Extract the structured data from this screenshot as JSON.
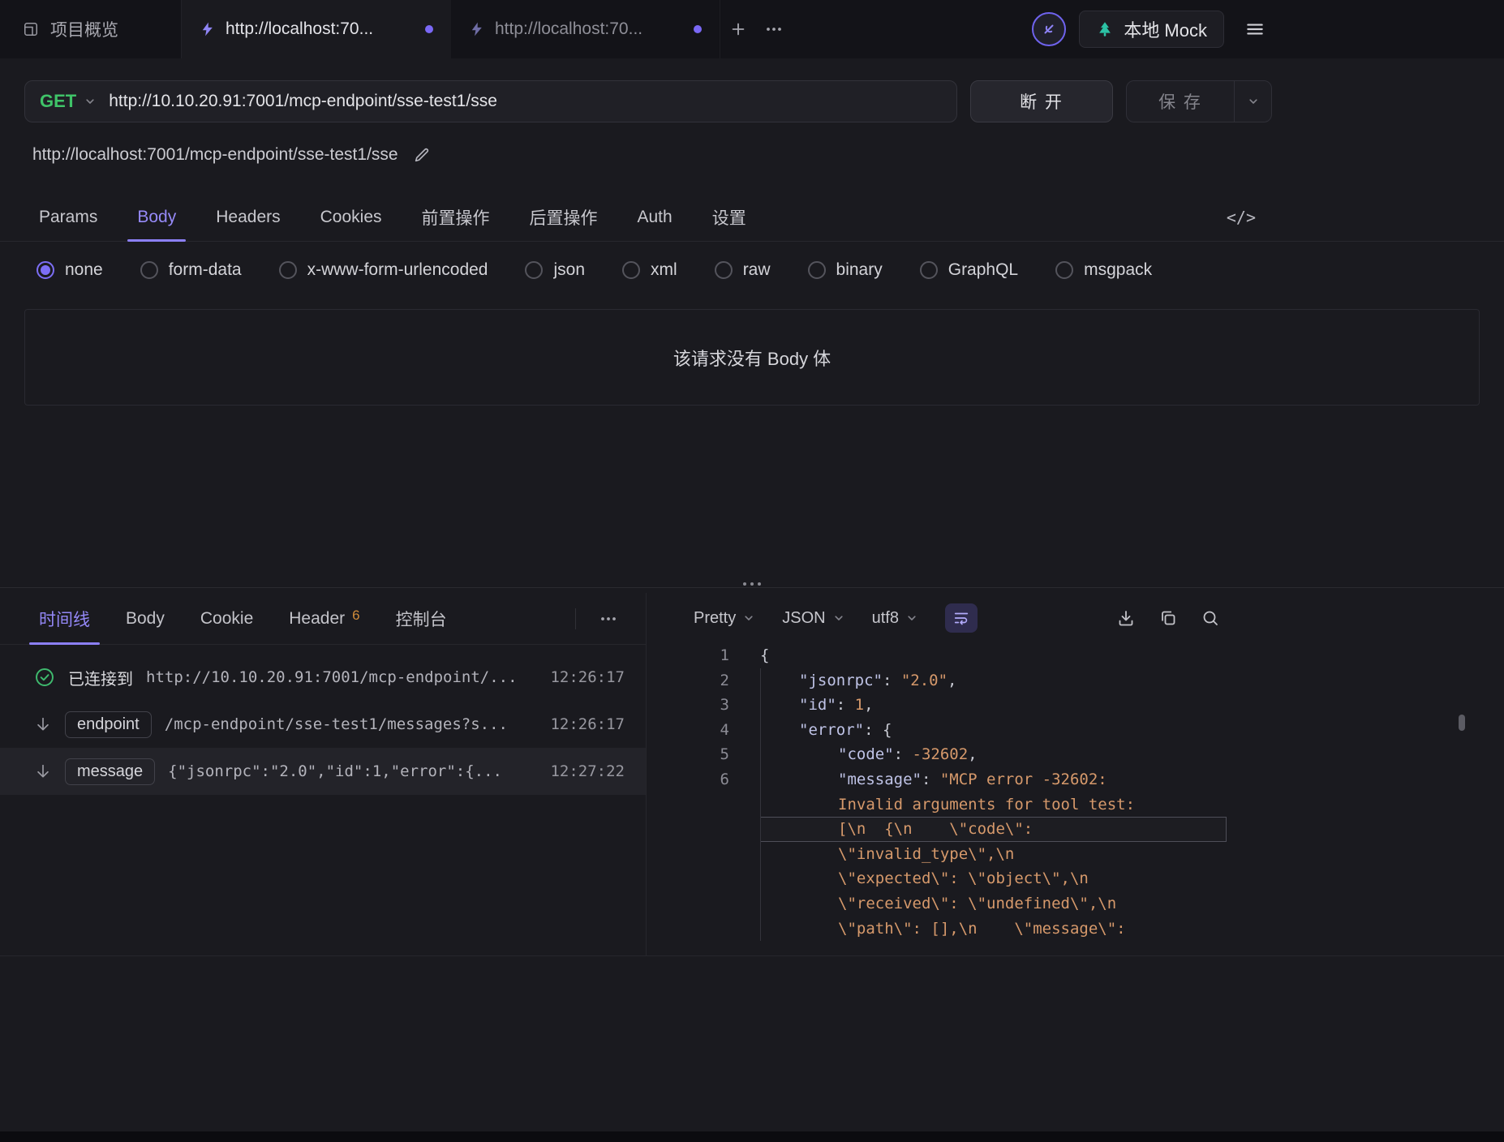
{
  "colors": {
    "accent_purple": "#8c80f8",
    "method_green": "#3fc368",
    "string_orange": "#d6996b",
    "badge_orange": "#d08c3a",
    "env_teal": "#2cc2a5",
    "success_green": "#3fba6e"
  },
  "topbar": {
    "project_tab": "项目概览",
    "doc_tabs": [
      {
        "label": "http://localhost:70...",
        "active": true
      },
      {
        "label": "http://localhost:70...",
        "active": false
      }
    ],
    "env_label": "本地 Mock"
  },
  "request": {
    "method": "GET",
    "url": "http://10.10.20.91:7001/mcp-endpoint/sse-test1/sse",
    "disconnect_label": "断 开",
    "save_label": "保 存",
    "resolved_url": "http://localhost:7001/mcp-endpoint/sse-test1/sse"
  },
  "icons": {
    "code_view": "</>"
  },
  "request_tabs": {
    "items": [
      "Params",
      "Body",
      "Headers",
      "Cookies",
      "前置操作",
      "后置操作",
      "Auth",
      "设置"
    ],
    "active": "Body"
  },
  "body_types": {
    "items": [
      "none",
      "form-data",
      "x-www-form-urlencoded",
      "json",
      "xml",
      "raw",
      "binary",
      "GraphQL",
      "msgpack"
    ],
    "selected": "none"
  },
  "body_empty_text": "该请求没有 Body 体",
  "response": {
    "tabs": [
      {
        "label": "时间线",
        "active": true
      },
      {
        "label": "Body"
      },
      {
        "label": "Cookie"
      },
      {
        "label": "Header",
        "badge": "6"
      },
      {
        "label": "控制台"
      }
    ],
    "timeline": [
      {
        "icon": "check-circle",
        "label": "已连接到",
        "text": "http://10.10.20.91:7001/mcp-endpoint/...",
        "time": "12:26:17"
      },
      {
        "icon": "arrow-down",
        "tag": "endpoint",
        "text": "/mcp-endpoint/sse-test1/messages?s...",
        "time": "12:26:17"
      },
      {
        "icon": "arrow-down",
        "tag": "message",
        "text": "{\"jsonrpc\":\"2.0\",\"id\":1,\"error\":{...",
        "time": "12:27:22",
        "selected": true
      }
    ],
    "viewer": {
      "format": "Pretty",
      "language": "JSON",
      "encoding": "utf8",
      "rows": [
        {
          "num": "1",
          "indent": 0,
          "tokens": [
            [
              "p",
              "{"
            ]
          ]
        },
        {
          "num": "2",
          "indent": 1,
          "tokens": [
            [
              "k",
              "\"jsonrpc\""
            ],
            [
              "p",
              ": "
            ],
            [
              "s",
              "\"2.0\""
            ],
            [
              "p",
              ","
            ]
          ]
        },
        {
          "num": "3",
          "indent": 1,
          "tokens": [
            [
              "k",
              "\"id\""
            ],
            [
              "p",
              ": "
            ],
            [
              "n",
              "1"
            ],
            [
              "p",
              ","
            ]
          ]
        },
        {
          "num": "4",
          "indent": 1,
          "tokens": [
            [
              "k",
              "\"error\""
            ],
            [
              "p",
              ": "
            ],
            [
              "p",
              "{"
            ]
          ]
        },
        {
          "num": "5",
          "indent": 2,
          "tokens": [
            [
              "k",
              "\"code\""
            ],
            [
              "p",
              ": "
            ],
            [
              "n",
              "-32602"
            ],
            [
              "p",
              ","
            ]
          ]
        },
        {
          "num": "6",
          "indent": 2,
          "tokens": [
            [
              "k",
              "\"message\""
            ],
            [
              "p",
              ": "
            ],
            [
              "s",
              "\"MCP error -32602:"
            ]
          ]
        },
        {
          "num": "",
          "indent": 2,
          "tokens": [
            [
              "s",
              "Invalid arguments for tool test:"
            ]
          ]
        },
        {
          "num": "",
          "indent": 2,
          "highlight": true,
          "tokens": [
            [
              "s",
              "[\\n  {\\n    \\\"code\\\":"
            ]
          ]
        },
        {
          "num": "",
          "indent": 2,
          "tokens": [
            [
              "s",
              "\\\"invalid_type\\\",\\n"
            ]
          ]
        },
        {
          "num": "",
          "indent": 2,
          "tokens": [
            [
              "s",
              "\\\"expected\\\": \\\"object\\\",\\n"
            ]
          ]
        },
        {
          "num": "",
          "indent": 2,
          "tokens": [
            [
              "s",
              "\\\"received\\\": \\\"undefined\\\",\\n"
            ]
          ]
        },
        {
          "num": "",
          "indent": 2,
          "tokens": [
            [
              "s",
              "\\\"path\\\": [],\\n    \\\"message\\\":"
            ]
          ]
        }
      ]
    }
  }
}
